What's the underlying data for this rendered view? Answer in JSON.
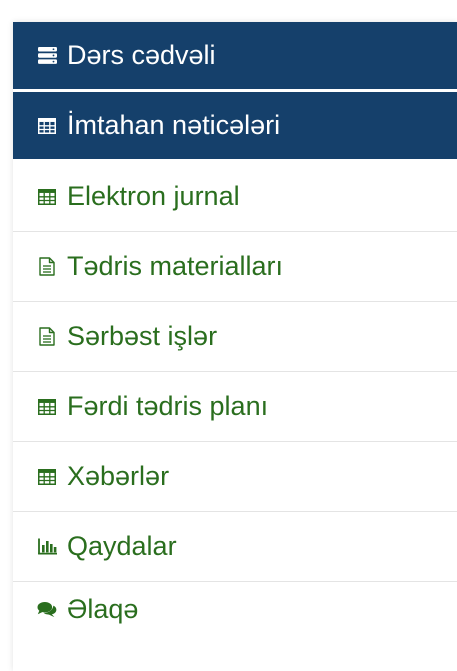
{
  "menu": {
    "items": [
      {
        "label": "Dərs cədvəli",
        "icon": "server-icon",
        "active": true
      },
      {
        "label": "İmtahan nəticələri",
        "icon": "table-icon",
        "active": true
      },
      {
        "label": "Elektron jurnal",
        "icon": "table-icon",
        "active": false
      },
      {
        "label": "Tədris materialları",
        "icon": "document-icon",
        "active": false
      },
      {
        "label": "Sərbəst işlər",
        "icon": "document-icon",
        "active": false
      },
      {
        "label": "Fərdi tədris planı",
        "icon": "table-icon",
        "active": false
      },
      {
        "label": "Xəbərlər",
        "icon": "table-icon",
        "active": false
      },
      {
        "label": "Qaydalar",
        "icon": "bar-chart-icon",
        "active": false
      },
      {
        "label": "Əlaqə",
        "icon": "comments-icon",
        "active": false
      }
    ]
  },
  "colors": {
    "active_background": "#15406b",
    "active_text": "#ffffff",
    "link_text": "#2a6e1e",
    "divider": "#e4e4e4"
  }
}
